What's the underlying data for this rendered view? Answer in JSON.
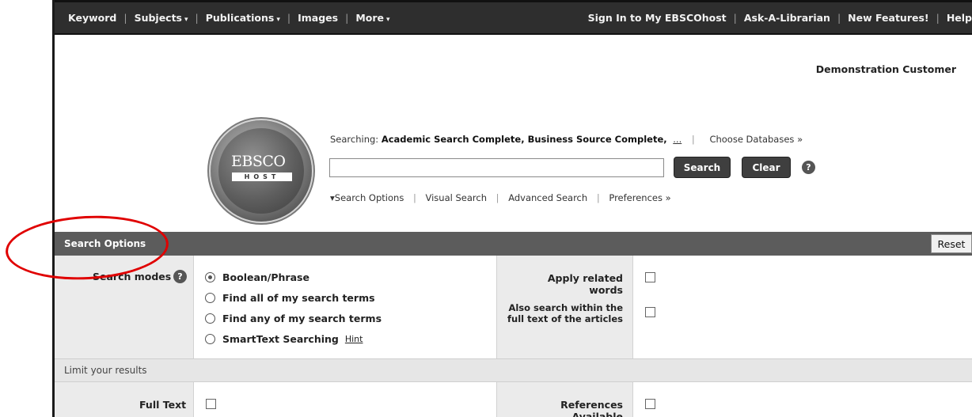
{
  "nav": {
    "keyword": "Keyword",
    "subjects": "Subjects",
    "publications": "Publications",
    "images": "Images",
    "more": "More",
    "sign_in": "Sign In to My EBSCOhost",
    "ask_librarian": "Ask-A-Librarian",
    "new_features": "New Features!",
    "help": "Help",
    "caret": "▾",
    "separator": "|"
  },
  "customer": "Demonstration Customer",
  "logo": {
    "ebsco": "EBSCO",
    "host": "HOST"
  },
  "search": {
    "searching_prefix": "Searching:",
    "databases": "Academic Search Complete, Business Source Complete,",
    "more_dots": "...",
    "choose_databases": "Choose Databases »",
    "input_value": "",
    "search_button": "Search",
    "clear_button": "Clear",
    "help_icon": "?"
  },
  "sublinks": {
    "search_options": "▾Search Options",
    "visual_search": "Visual Search",
    "advanced_search": "Advanced Search",
    "preferences": "Preferences »"
  },
  "options": {
    "header": "Search Options",
    "reset": "Reset",
    "search_modes_label": "Search modes",
    "modes": [
      {
        "label": "Boolean/Phrase",
        "selected": true
      },
      {
        "label": "Find all of my search terms",
        "selected": false
      },
      {
        "label": "Find any of my search terms",
        "selected": false
      },
      {
        "label": "SmartText Searching",
        "selected": false
      }
    ],
    "hint": "Hint",
    "apply_related": "Apply related words",
    "also_search_line1": "Also search within the",
    "also_search_line2": "full text of the articles"
  },
  "limits": {
    "header": "Limit your results",
    "full_text": "Full Text",
    "references_available": "References Available"
  },
  "colors": {
    "annotation": "#e00000",
    "topbar": "#2e2e2e",
    "header": "#5c5c5c"
  }
}
